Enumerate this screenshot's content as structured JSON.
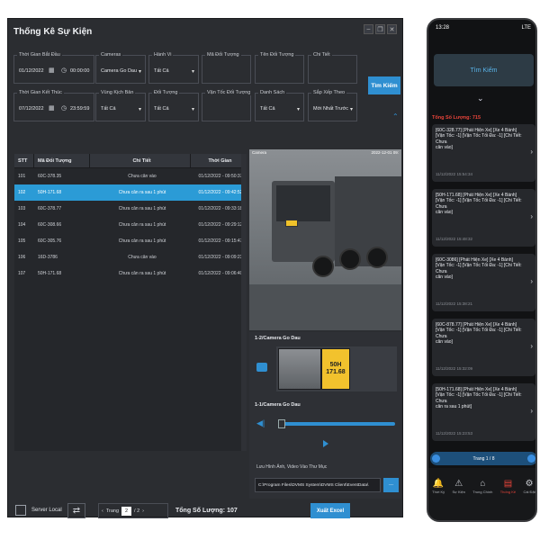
{
  "desktop": {
    "title": "Thống Kê Sự Kiện",
    "filters": {
      "start_label": "Thời Gian Bắt Đầu",
      "start_date": "01/12/2022",
      "start_time": "00:00:00",
      "end_label": "Thời Gian Kết Thúc",
      "end_date": "07/12/2022",
      "end_time": "23:59:59",
      "cameras_label": "Cameras",
      "cameras_value": "Camera Go Dau",
      "behavior_label": "Hành Vi",
      "behavior_value": "Tất Cả",
      "object_code_label": "Mã Đối Tượng",
      "object_name_label": "Tên Đối Tượng",
      "detail_label": "Chi Tiết",
      "zone_label": "Vùng Kịch Bản",
      "zone_value": "Tất Cả",
      "object_label": "Đối Tượng",
      "object_value": "Tất Cả",
      "speed_label": "Vận Tốc Đối Tượng",
      "list_label": "Danh Sách",
      "list_value": "Tất Cả",
      "sort_label": "Sắp Xếp Theo",
      "sort_value": "Mới Nhất Trước",
      "search_button": "Tìm Kiếm"
    },
    "table": {
      "headers": [
        "STT",
        "Mã Đối Tượng",
        "Chi Tiết",
        "Thời Gian"
      ],
      "rows": [
        {
          "stt": "101",
          "code": "60C-378.35",
          "detail": "Chưa cân vào",
          "time": "01/12/2022 - 09:50:37"
        },
        {
          "stt": "102",
          "code": "50H-171.68",
          "detail": "Chưa cân ra sau 1 phút",
          "time": "01/12/2022 - 09:42:52"
        },
        {
          "stt": "103",
          "code": "60C-378.77",
          "detail": "Chưa cân ra sau 1 phút",
          "time": "01/12/2022 - 09:33:18"
        },
        {
          "stt": "104",
          "code": "60C-308.66",
          "detail": "Chưa cân ra sau 1 phút",
          "time": "01/12/2022 - 09:29:12"
        },
        {
          "stt": "105",
          "code": "60C-305.76",
          "detail": "Chưa cân ra sau 1 phút",
          "time": "01/12/2022 - 09:15:47"
        },
        {
          "stt": "106",
          "code": "16D-3786",
          "detail": "Chưa cân vào",
          "time": "01/12/2022 - 09:09:23"
        },
        {
          "stt": "107",
          "code": "50H-171.68",
          "detail": "Chưa cân ra sau 1 phút",
          "time": "01/12/2022 - 09:06:40"
        }
      ],
      "selected_index": 1
    },
    "camera_view": {
      "label": "Camera",
      "timestamp": "2022-12-01 09:"
    },
    "panel": {
      "cam2_title": "1-2/Camera Go Dau",
      "plate_line1": "50H",
      "plate_line2": "171.68",
      "cam1_title": "1-1/Camera Go Dau",
      "save_label": "Lưu Hình Ảnh, Video Vào Thư Mục",
      "save_path": "C:\\Program Files\\DVMS System\\DVMS Client\\EventData\\",
      "browse": "..."
    },
    "footer": {
      "server": "Server Local",
      "page_label": "Trang",
      "page_current": "2",
      "page_total": "/ 2",
      "total": "Tổng Số Lượng: 107",
      "export": "Xuất Excel"
    }
  },
  "phone": {
    "time": "13:28",
    "signal": "LTE",
    "search": "Tìm Kiếm",
    "count": "Tổng Số Lượng: 715",
    "cards": [
      {
        "l1": "[60C-328.77] [Phát Hiện Xe] [Xe 4 Bánh]",
        "l2": "[Vận Tốc: -1] [Vận Tốc Tối Đa: -1] [Chi Tiết: Chưa",
        "l3": "cân vào]",
        "ts": "11/12/2022 15:54:34"
      },
      {
        "l1": "[50H-171.68] [Phát Hiện Xe] [Xe 4 Bánh]",
        "l2": "[Vận Tốc: -1] [Vận Tốc Tối Đa: -1] [Chi Tiết: Chưa",
        "l3": "cân vào]",
        "ts": "11/12/2022 15:48:32"
      },
      {
        "l1": "[60C-3086] [Phát Hiện Xe] [Xe 4 Bánh]",
        "l2": "[Vận Tốc: -1] [Vận Tốc Tối Đa: -1] [Chi Tiết: Chưa",
        "l3": "cân vào]",
        "ts": "11/12/2022 15:38:21"
      },
      {
        "l1": "[60C-878.77] [Phát Hiện Xe] [Xe 4 Bánh]",
        "l2": "[Vận Tốc: -1] [Vận Tốc Tối Đa: -1] [Chi Tiết: Chưa",
        "l3": "cân vào]",
        "ts": "11/12/2022 15:32:09"
      },
      {
        "l1": "[50H-171.68] [Phát Hiện Xe] [Xe 4 Bánh]",
        "l2": "[Vận Tốc: -1] [Vận Tốc Tối Đa: -1] [Chi Tiết: Chưa",
        "l3": "cân ra sau 1 phút]",
        "ts": "11/12/2022 15:23:53"
      }
    ],
    "pager": "Trang 1 / 8",
    "tabs": [
      "Thời Ký",
      "Sự Kiện",
      "Trung Chính",
      "Thống Kê",
      "Cài Đặt"
    ]
  }
}
